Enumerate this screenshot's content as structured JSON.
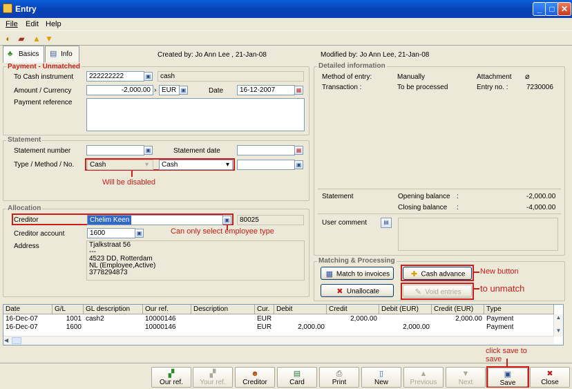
{
  "window": {
    "title": "Entry",
    "min": "_",
    "max": "□",
    "close": "✕"
  },
  "menu": {
    "file": "File",
    "edit": "Edit",
    "help": "Help"
  },
  "tabs": {
    "basics": "Basics",
    "info": "Info"
  },
  "header": {
    "created": "Created by: Jo Ann Lee , 21-Jan-08",
    "modified": "Modified by: Jo Ann Lee, 21-Jan-08"
  },
  "payment": {
    "section_title": "Payment - Unmatched",
    "cash_instrument_label": "To Cash instrument",
    "cash_instrument_value": "222222222",
    "cash_instrument_name": "cash",
    "amount_label": "Amount / Currency",
    "amount_value": "-2,000.00",
    "currency_value": "EUR",
    "date_label": "Date",
    "date_value": "16-12-2007",
    "reference_label": "Payment reference",
    "reference_value": ""
  },
  "statement": {
    "section_title": "Statement",
    "number_label": "Statement number",
    "number_value": "",
    "date_label": "Statement date",
    "date_value": "",
    "type_label": "Type / Method / No.",
    "type_value": "Cash",
    "method_value": "Cash",
    "no_value": "",
    "note": "Will be disabled"
  },
  "allocation": {
    "section_title": "Allocation",
    "creditor_label": "Creditor",
    "creditor_value": "Chelim Keen",
    "creditor_code": "80025",
    "note": "Can only select employee type",
    "account_label": "Creditor account",
    "account_value": "1600",
    "address_label": "Address",
    "address_lines": [
      "Tjalkstraat 56",
      "---",
      "4523 DD, Rotterdam",
      "NL (Employee,Active)",
      "3778294873"
    ]
  },
  "detailed": {
    "section_title": "Detailed information",
    "method_label": "Method of entry:",
    "method_value": "Manually",
    "transaction_label": "Transaction :",
    "transaction_value": "To be processed",
    "attachment_label": "Attachment",
    "entry_label": "Entry no. :",
    "entry_value": "7230006",
    "statement_label": "Statement",
    "opening_label": "Opening balance",
    "opening_sep": ":",
    "opening_value": "-2,000.00",
    "closing_label": "Closing balance",
    "closing_sep": ":",
    "closing_value": "-4,000.00",
    "comment_label": "User comment",
    "comment_value": ""
  },
  "matching": {
    "section_title": "Matching & Processing",
    "match_label": "Match to invoices",
    "cash_advance_label": "Cash advance",
    "unallocate_label": "Unallocate",
    "void_label": "Void entries",
    "note_new": "New button",
    "note_unmatch": "to unmatch"
  },
  "table": {
    "columns": [
      "Date",
      "G/L",
      "GL description",
      "Our ref.",
      "Description",
      "Cur.",
      "Debit",
      "Credit",
      "Debit (EUR)",
      "Credit (EUR)",
      "Type"
    ],
    "rows": [
      [
        "16-Dec-07",
        "1001",
        "cash2",
        "10000146",
        "",
        "EUR",
        "",
        "2,000.00",
        "",
        "2,000.00",
        "Payment"
      ],
      [
        "16-Dec-07",
        "1600",
        "",
        "10000146",
        "",
        "EUR",
        "2,000.00",
        "",
        "2,000.00",
        "",
        "Payment"
      ]
    ]
  },
  "bottom": {
    "ourref": "Our ref.",
    "yourref": "Your ref.",
    "creditor": "Creditor",
    "card": "Card",
    "print": "Print",
    "new": "New",
    "previous": "Previous",
    "next": "Next",
    "save": "Save",
    "close": "Close",
    "save_note": "click save to save"
  }
}
